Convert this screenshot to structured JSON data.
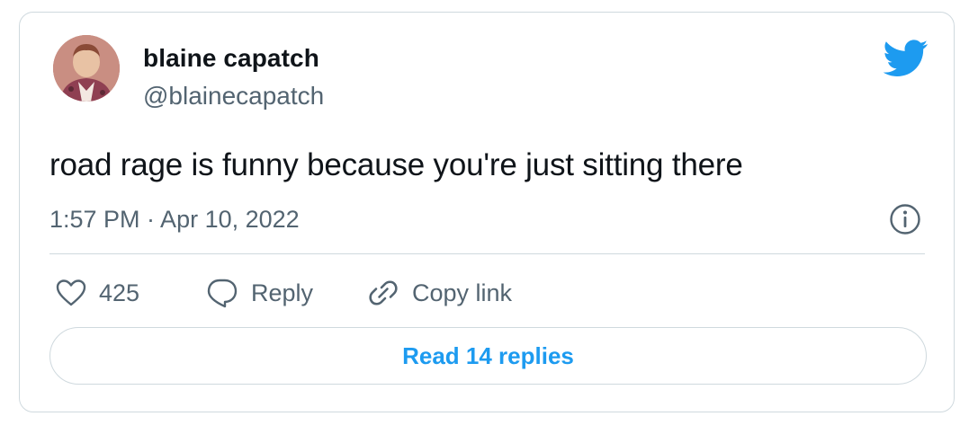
{
  "author": {
    "name": "blaine capatch",
    "handle": "@blainecapatch",
    "avatar_icon": "profile-photo"
  },
  "brand": {
    "logo_icon": "twitter-bird-icon",
    "color": "#1d9bf0"
  },
  "tweet": {
    "text": "road rage is funny because you're just sitting there",
    "timestamp": "1:57 PM · Apr 10, 2022"
  },
  "actions": {
    "like_count": "425",
    "reply_label": "Reply",
    "copy_link_label": "Copy link"
  },
  "footer": {
    "read_replies_label": "Read 14 replies"
  },
  "icons": {
    "like": "heart-outline-icon",
    "reply": "speech-bubble-icon",
    "copy": "link-chain-icon",
    "info": "info-circle-icon"
  }
}
